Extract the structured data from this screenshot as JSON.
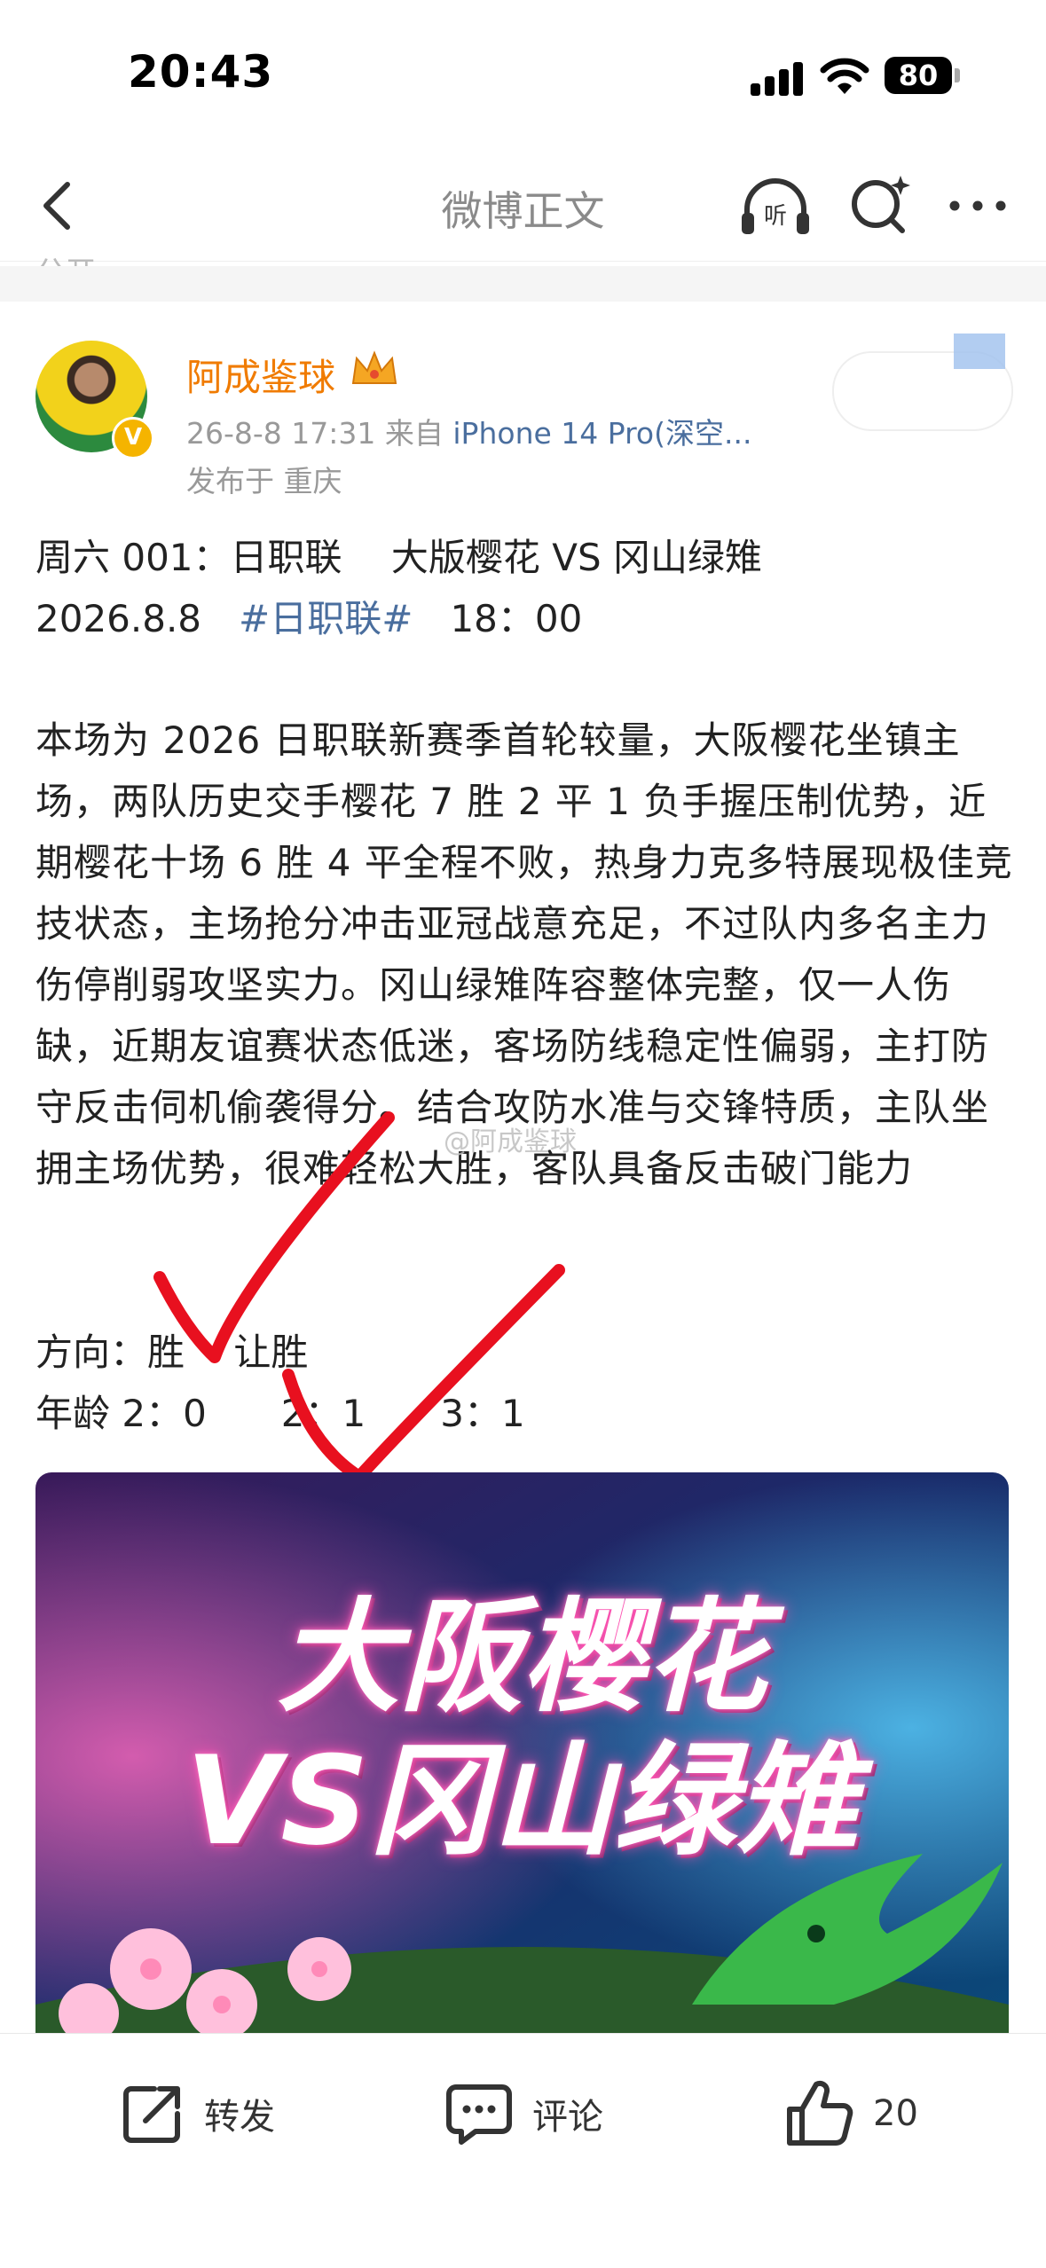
{
  "status_bar": {
    "time": "20:43",
    "battery": "80"
  },
  "nav": {
    "title": "微博正文",
    "public_remnant": "公开"
  },
  "author": {
    "name": "阿成鉴球",
    "date": "26-8-8 17:31",
    "from_label": "来自",
    "source": "iPhone 14 Pro(深空...",
    "location": "发布于 重庆"
  },
  "post": {
    "headline_line1": "周六 001：日职联　 大版樱花 VS 冈山绿雉",
    "headline_line2_date": "2026.8.8　",
    "headline_line2_tag": "#日职联#",
    "headline_line2_time": "　18：00",
    "body": "本场为 2026 日职联新赛季首轮较量，大阪樱花坐镇主场，两队历史交手樱花 7 胜 2 平 1 负手握压制优势，近期樱花十场 6 胜 4 平全程不败，热身力克多特展现极佳竞技状态，主场抢分冲击亚冠战意充足，不过队内多名主力伤停削弱攻坚实力。冈山绿雉阵容整体完整，仅一人伤缺，近期友谊赛状态低迷，客场防线稳定性偏弱，主打防守反击伺机偷袭得分。结合攻防水准与交锋特质，主队坐拥主场优势，很难轻松大胜，客队具备反击破门能力",
    "direction": "方向：胜　 让胜",
    "scores": "年龄 2：0　　2：1　　3：1",
    "watermark": "@阿成鉴球"
  },
  "image": {
    "line1": "大阪樱花",
    "line2": "VS冈山绿雉"
  },
  "actions": {
    "repost": "转发",
    "comment": "评论",
    "like_count": "20"
  }
}
